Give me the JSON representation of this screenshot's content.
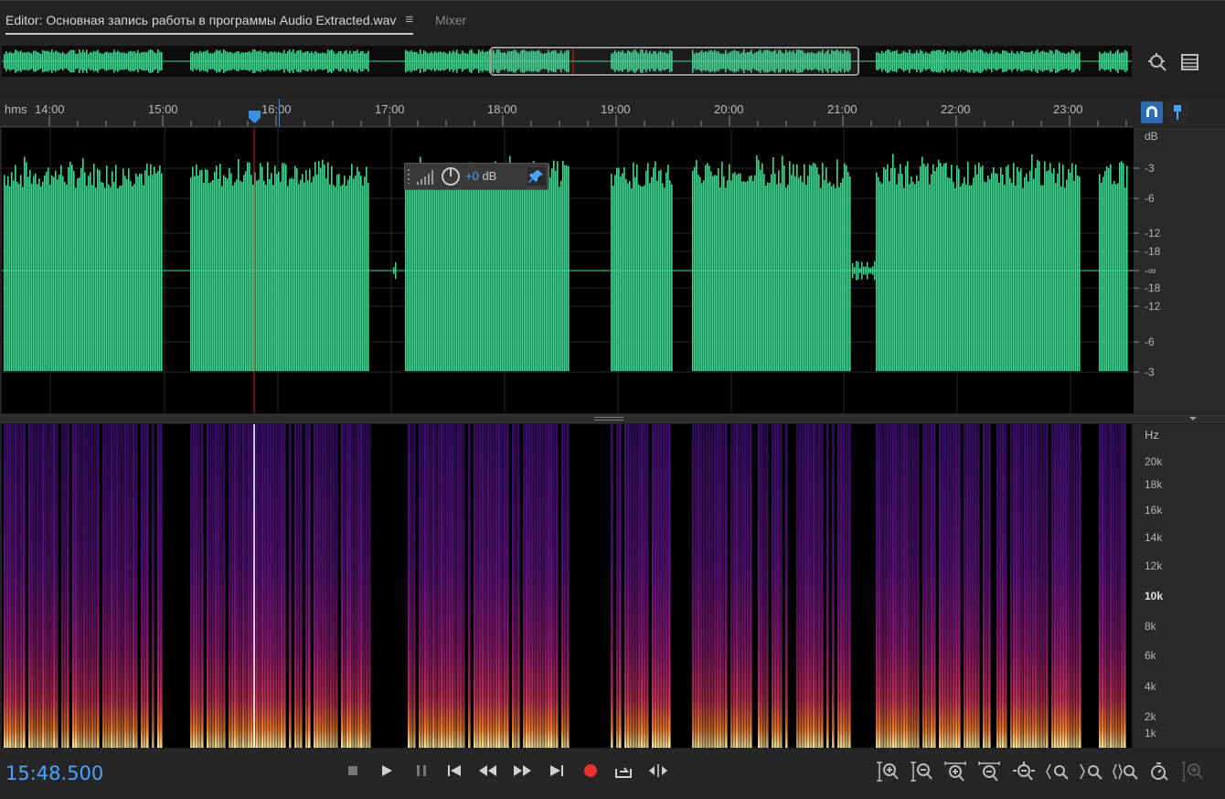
{
  "tabs": {
    "editor_label": "Editor: Основная запись работы в программы Audio Extracted.wav",
    "editor_menu_icon": "hamburger-icon",
    "mixer_label": "Mixer"
  },
  "ruler": {
    "unit": "hms",
    "ticks": [
      "14:00",
      "15:00",
      "16:00",
      "17:00",
      "18:00",
      "19:00",
      "20:00",
      "21:00",
      "22:00",
      "23:00"
    ]
  },
  "db_scale": {
    "unit": "dB",
    "labels": [
      "-3",
      "-6",
      "-12",
      "-18",
      "-∞",
      "-18",
      "-12",
      "-6",
      "-3"
    ]
  },
  "hz_scale": {
    "unit": "Hz",
    "labels": [
      "20k",
      "18k",
      "16k",
      "14k",
      "12k",
      "10k",
      "8k",
      "6k",
      "4k",
      "2k",
      "1k"
    ]
  },
  "hud": {
    "gain_sign": "+0",
    "gain_unit": " dB"
  },
  "playhead": {
    "time": "15:48.500"
  },
  "transport": [
    "stop",
    "play",
    "pause",
    "go-to-start",
    "rewind",
    "fast-forward",
    "go-to-end",
    "record",
    "loop",
    "skip-selection"
  ],
  "zoom_tools": [
    "zoom-in-amplitude",
    "zoom-out-amplitude",
    "zoom-in-time",
    "zoom-out-time",
    "zoom-out-full",
    "zoom-to-selection-left",
    "zoom-to-selection-right",
    "zoom-selection",
    "zoom-reset",
    "zoom-in-disabled"
  ],
  "colors": {
    "waveform": "#3cd890",
    "accent": "#4aa3ff",
    "record": "#e8322e",
    "playhead": "#d01f1f"
  }
}
